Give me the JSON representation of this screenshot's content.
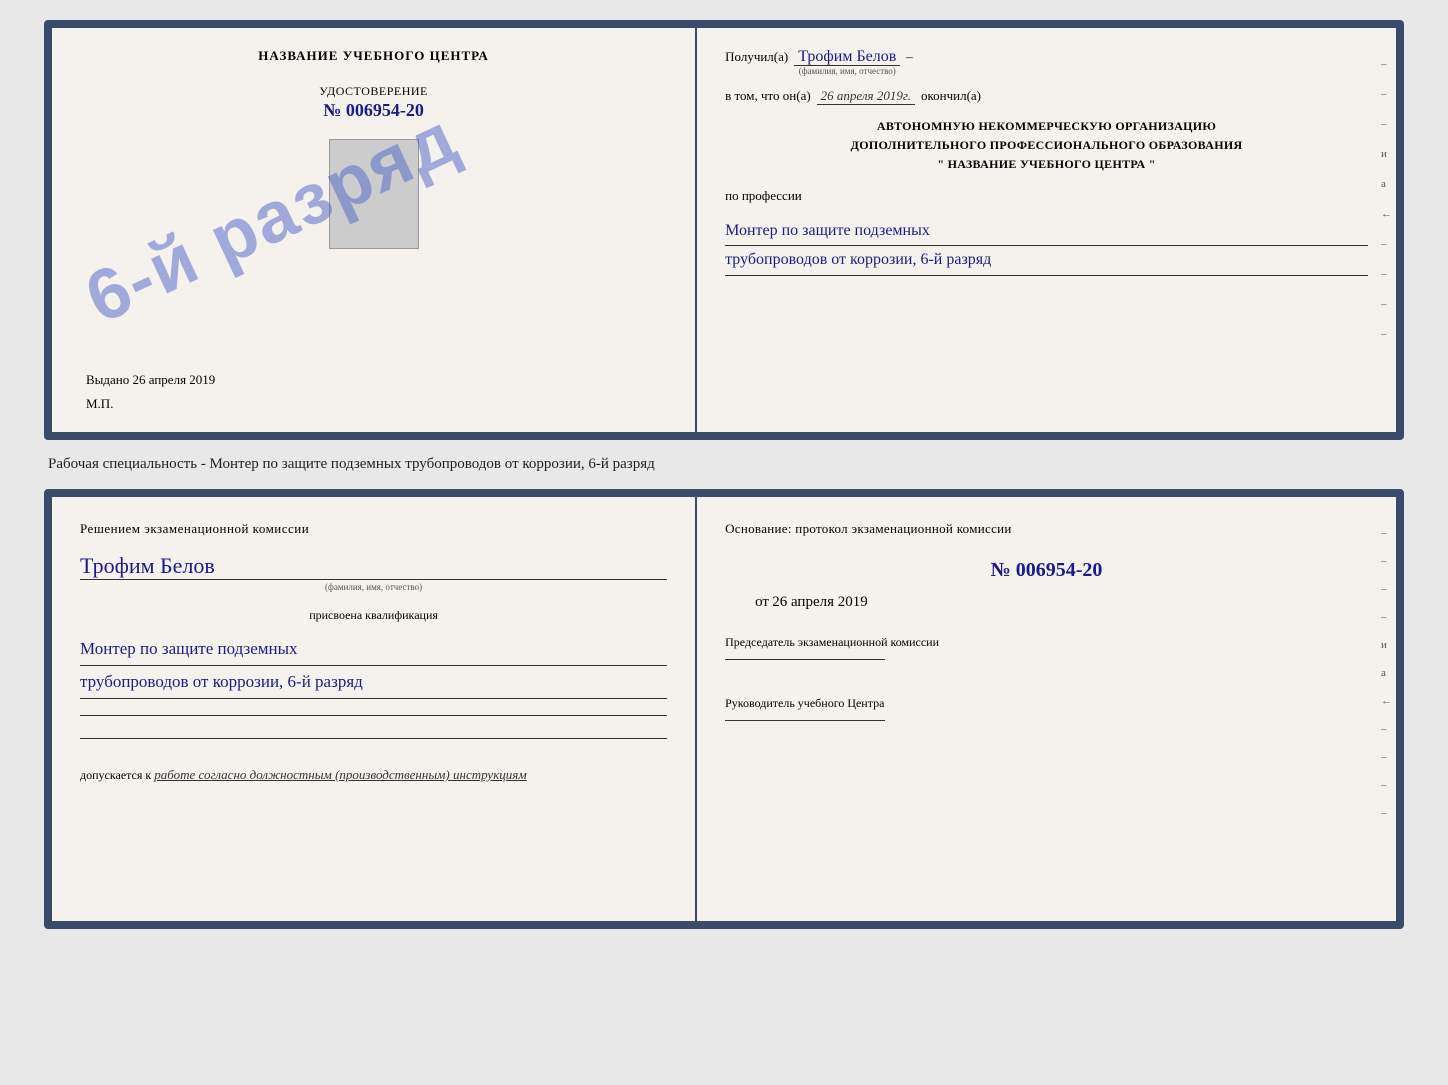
{
  "page": {
    "bg_color": "#e8e8e8"
  },
  "diploma": {
    "left": {
      "title": "НАЗВАНИЕ УЧЕБНОГО ЦЕНТРА",
      "udostoverenie_label": "УДОСТОВЕРЕНИЕ",
      "number_prefix": "№",
      "number": "006954-20",
      "issued_label": "Выдано",
      "issued_date": "26 апреля 2019",
      "mp_label": "М.П.",
      "stamp_text": "6-й разряд"
    },
    "right": {
      "received_label": "Получил(а)",
      "name_handwritten": "Трофим Белов",
      "name_sublabel": "(фамилия, имя, отчество)",
      "dash": "–",
      "in_that_label": "в том, что он(а)",
      "date_handwritten": "26 апреля 2019г.",
      "finished_label": "окончил(а)",
      "org_line1": "АВТОНОМНУЮ НЕКОММЕРЧЕСКУЮ ОРГАНИЗАЦИЮ",
      "org_line2": "ДОПОЛНИТЕЛЬНОГО ПРОФЕССИОНАЛЬНОГО ОБРАЗОВАНИЯ",
      "org_line3": "\" НАЗВАНИЕ УЧЕБНОГО ЦЕНТРА \"",
      "profession_label": "по профессии",
      "profession_line1": "Монтер по защите подземных",
      "profession_line2": "трубопроводов от коррозии, 6-й разряд",
      "side_marks": [
        "–",
        "–",
        "–",
        "и",
        "а",
        "←",
        "–",
        "–",
        "–",
        "–"
      ]
    }
  },
  "subtitle": "Рабочая специальность - Монтер по защите подземных трубопроводов от коррозии, 6-й разряд",
  "cert": {
    "left": {
      "decision_title": "Решением экзаменационной комиссии",
      "name_handwritten": "Трофим Белов",
      "name_sublabel": "(фамилия, имя, отчество)",
      "assigned_label": "присвоена квалификация",
      "profession_line1": "Монтер по защите подземных",
      "profession_line2": "трубопроводов от коррозии, 6-й разряд",
      "admission_prefix": "допускается к",
      "admission_text": "работе согласно должностным (производственным) инструкциям"
    },
    "right": {
      "basis_label": "Основание: протокол экзаменационной комиссии",
      "number_prefix": "№",
      "number": "006954-20",
      "date_prefix": "от",
      "date": "26 апреля 2019",
      "chairman_title": "Председатель экзаменационной комиссии",
      "director_title": "Руководитель учебного Центра",
      "side_marks": [
        "–",
        "–",
        "–",
        "–",
        "и",
        "а",
        "←",
        "–",
        "–",
        "–",
        "–"
      ]
    }
  }
}
